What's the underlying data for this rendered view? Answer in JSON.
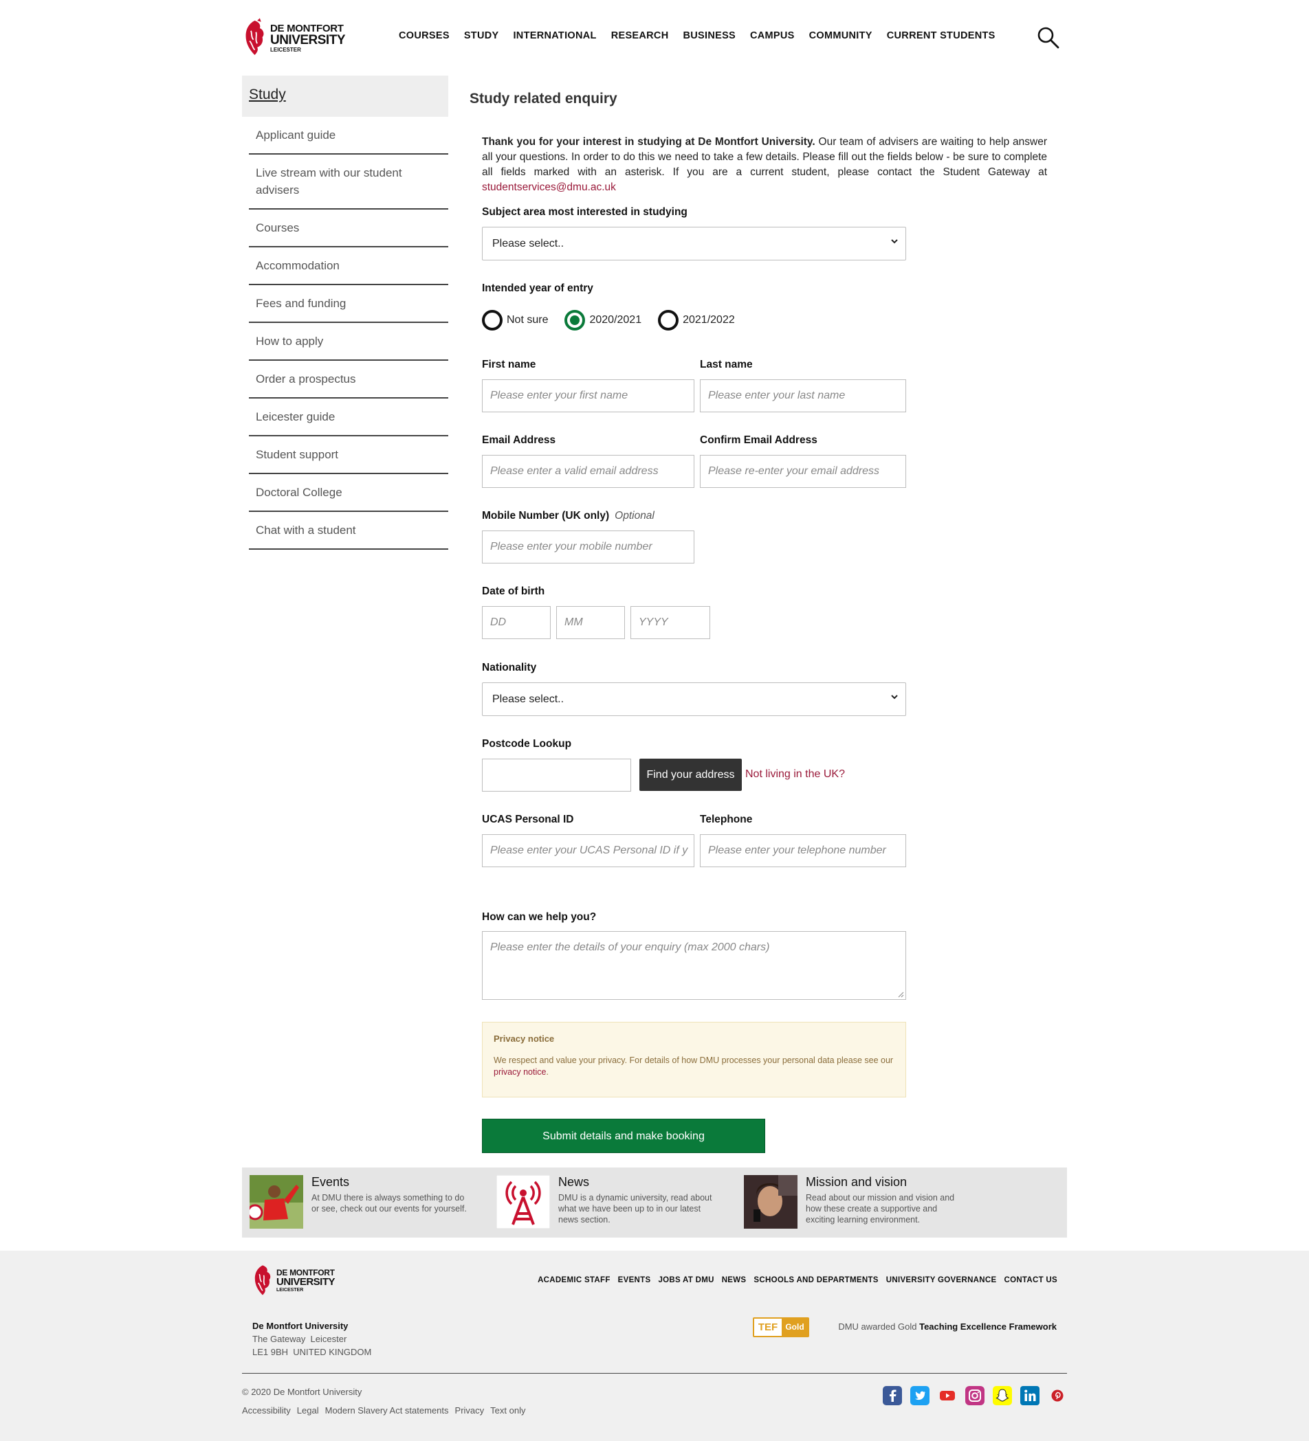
{
  "brand": {
    "line1": "DE MONTFORT",
    "line2": "UNIVERSITY",
    "line3": "LEICESTER",
    "color": "#c8102e"
  },
  "nav": {
    "items": [
      "COURSES",
      "STUDY",
      "INTERNATIONAL",
      "RESEARCH",
      "BUSINESS",
      "CAMPUS",
      "COMMUNITY",
      "CURRENT STUDENTS"
    ],
    "search_icon": "search-icon"
  },
  "sidebar": {
    "title": "Study",
    "items": [
      "Applicant guide",
      "Live stream with our student advisers",
      "Courses",
      "Accommodation",
      "Fees and funding",
      "How to apply",
      "Order a prospectus",
      "Leicester guide",
      "Student support",
      "Doctoral College",
      "Chat with a student"
    ]
  },
  "page": {
    "title": "Study related enquiry",
    "intro_bold": "Thank you for your interest in studying at De Montfort University.",
    "intro_rest": " Our team of advisers are waiting to help answer all your questions. In order to do this we need to take a few details. Please fill out the fields below - be sure to complete all fields marked with an asterisk. If you are a current student, please contact the Student Gateway at ",
    "intro_email": "studentservices@dmu.ac.uk"
  },
  "form": {
    "subject": {
      "label": "Subject area most interested in studying",
      "value": "Please select.."
    },
    "year": {
      "label": "Intended year of entry",
      "options": [
        "Not sure",
        "2020/2021",
        "2021/2022"
      ],
      "selected": "2020/2021"
    },
    "first_name": {
      "label": "First name",
      "placeholder": "Please enter your first name"
    },
    "last_name": {
      "label": "Last name",
      "placeholder": "Please enter your last name"
    },
    "email": {
      "label": "Email Address",
      "placeholder": "Please enter a valid email address"
    },
    "confirm_email": {
      "label": "Confirm Email Address",
      "placeholder": "Please re-enter your email address"
    },
    "mobile": {
      "label": "Mobile Number (UK only)",
      "optional": "Optional",
      "placeholder": "Please enter your mobile number"
    },
    "dob": {
      "label": "Date of birth",
      "dd": "DD",
      "mm": "MM",
      "yyyy": "YYYY"
    },
    "nationality": {
      "label": "Nationality",
      "value": "Please select.."
    },
    "postcode": {
      "label": "Postcode Lookup",
      "value": "",
      "button": "Find your address",
      "not_uk": "Not living in the UK?"
    },
    "ucas": {
      "label": "UCAS Personal ID",
      "placeholder": "Please enter your UCAS Personal ID if y"
    },
    "telephone": {
      "label": "Telephone",
      "placeholder": "Please enter your telephone number"
    },
    "help": {
      "label": "How can we help you?",
      "placeholder": "Please enter the details of your enquiry (max 2000 chars)"
    },
    "privacy": {
      "heading": "Privacy notice",
      "text": "We respect and value your privacy. For details of how DMU processes your personal data please see our ",
      "link": "privacy notice",
      "end": "."
    },
    "submit": "Submit details and make booking",
    "accent_color": "#0a7a3a"
  },
  "promo": [
    {
      "title": "Events",
      "desc": "At DMU there is always something to do or see, check out our events for yourself.",
      "icon": "events-photo"
    },
    {
      "title": "News",
      "desc": "DMU is a dynamic university, read about what we have been up to in our latest news section.",
      "icon": "broadcast-tower-icon"
    },
    {
      "title": "Mission and vision",
      "desc": "Read about our mission and vision and how these create a supportive and exciting learning environment.",
      "icon": "student-photo"
    }
  ],
  "footer": {
    "nav": [
      "ACADEMIC STAFF",
      "EVENTS",
      "JOBS AT DMU",
      "NEWS",
      "SCHOOLS AND DEPARTMENTS",
      "UNIVERSITY GOVERNANCE",
      "CONTACT US"
    ],
    "address": {
      "name": "De Montfort University",
      "line1": "The Gateway  Leicester",
      "line2": "LE1 9BH  UNITED KINGDOM"
    },
    "tef_badge": {
      "left": "TEF",
      "right": "Gold"
    },
    "tef_text_pre": "DMU awarded Gold ",
    "tef_text_bold": "Teaching Excellence Framework",
    "copyright": "© 2020 De Montfort University",
    "links": [
      "Accessibility",
      "Legal",
      "Modern Slavery Act statements",
      "Privacy",
      "Text only"
    ],
    "social": [
      "facebook-icon",
      "twitter-icon",
      "youtube-icon",
      "instagram-icon",
      "snapchat-icon",
      "linkedin-icon",
      "pinterest-icon"
    ]
  }
}
